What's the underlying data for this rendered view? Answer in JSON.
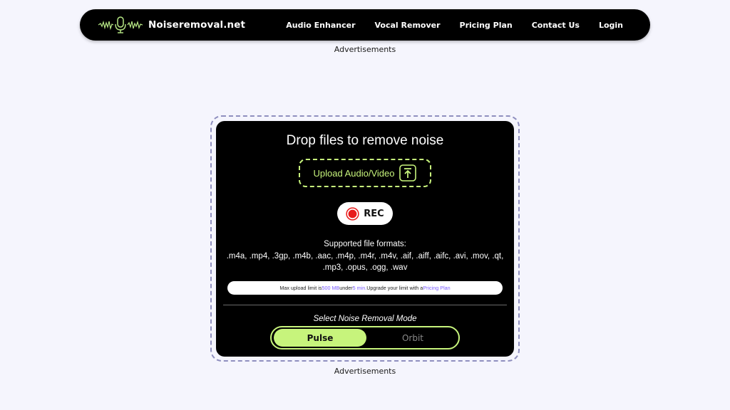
{
  "navbar": {
    "brand_name": "Noiseremoval.net",
    "links": [
      "Audio Enhancer",
      "Vocal Remover",
      "Pricing Plan",
      "Contact Us",
      "Login"
    ]
  },
  "ads": {
    "top_label": "Advertisements",
    "bottom_label": "Advertisements"
  },
  "uploader": {
    "title": "Drop files to remove noise",
    "upload_label": "Upload Audio/Video",
    "rec_label": "REC",
    "formats_heading": "Supported file formats:",
    "formats_list": ".m4a, .mp4, .3gp, .m4b, .aac, .m4p, .m4r, .m4v, .aif, .aiff, .aifc, .avi, .mov, .qt, .mp3, .opus, .ogg, .wav",
    "limit": {
      "prefix": "Max upload limit is ",
      "size": "500 MB",
      "middle": " under ",
      "duration": "5 min.",
      "suffix": " Upgrade your limit with a ",
      "link": "Pricing Plan"
    }
  },
  "mode": {
    "heading": "Select Noise Removal Mode",
    "options": [
      "Pulse",
      "Orbit"
    ],
    "selected": "Pulse"
  },
  "colors": {
    "accent": "#c7f47c",
    "highlight": "#7b5cff",
    "rec_red": "#e81b1b",
    "page_bg": "#f5f5fd"
  },
  "icons": {
    "logo": "waveform-mic-icon",
    "upload": "upload-arrow-icon",
    "rec": "record-dot-icon"
  }
}
